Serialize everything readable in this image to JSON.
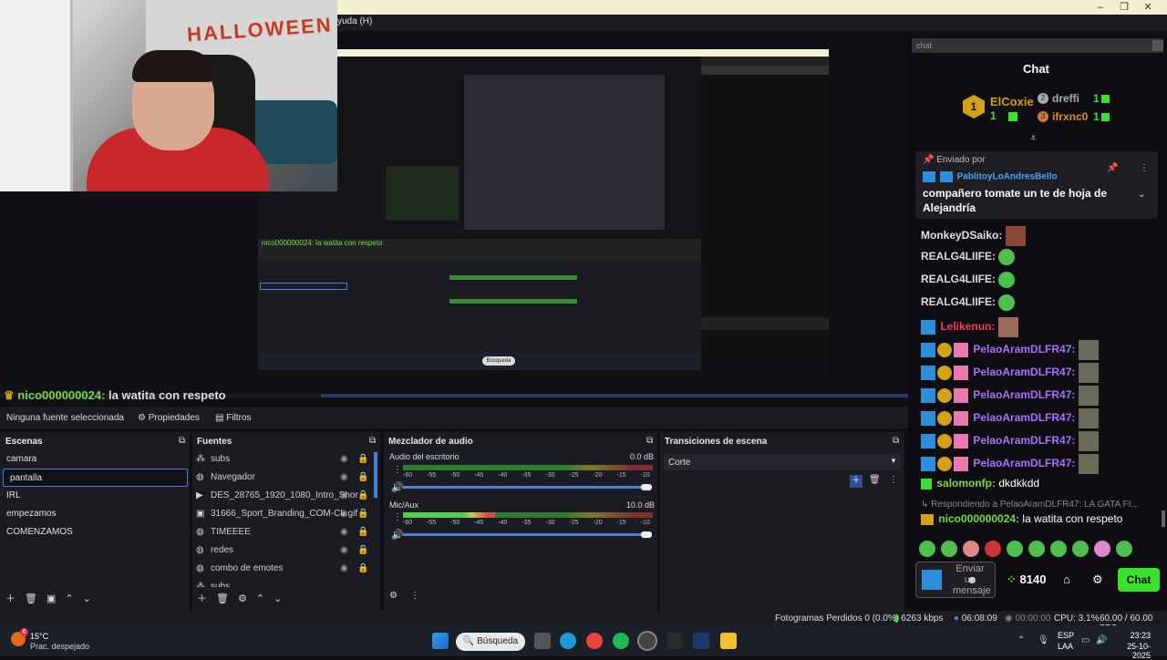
{
  "window": {
    "menu_fragment": "yuda (H)"
  },
  "webcam": {
    "banner": "HALLOWEEN"
  },
  "preview": {
    "nested_ticker": "nico000000024: la watita con respeto",
    "nested_search": "Búsqueda"
  },
  "ticker": {
    "user": "nico000000024:",
    "message": "la watita con respeto",
    "user_color": "#7bd64a"
  },
  "source_toolbar": {
    "no_source": "Ninguna fuente seleccionada",
    "properties": "Propiedades",
    "filters": "Filtros"
  },
  "scenes": {
    "title": "Escenas",
    "items": [
      "camara",
      "pantalla",
      "IRL",
      "empezamos",
      "COMENZAMOS"
    ],
    "selected": 1
  },
  "sources": {
    "title": "Fuentes",
    "items": [
      "subs",
      "Navegador",
      "DES_28765_1920_1080_Intro_Shor",
      "31666_Sport_Branding_COM-CL.gif",
      "TIMEEEE",
      "redes",
      "combo de emotes",
      "subs"
    ]
  },
  "mixer": {
    "title": "Mezclador de audio",
    "channels": [
      {
        "name": "Audio del escritorio",
        "db": "0.0 dB",
        "level": 0.0
      },
      {
        "name": "Mic/Aux",
        "db": "10.0 dB",
        "level": 0.37
      }
    ],
    "ticks": "-60 -55 -50 -45 -40 -35 -30 -25 -20 -15 -10 -5 0"
  },
  "transitions": {
    "title": "Transiciones de escena",
    "current": "Corte"
  },
  "chat": {
    "input_placeholder": "chat",
    "title": "Chat",
    "leaderboard": [
      {
        "rank": "1",
        "name": "ElCoxie",
        "count": "1"
      },
      {
        "rank": "2",
        "name": "dreffi",
        "count": "1"
      },
      {
        "rank": "3",
        "name": "ifrxnc0",
        "count": "1"
      }
    ],
    "pinned": {
      "label": "Enviado por",
      "user": "PablitoyLoAndresBello",
      "text": "compañero tomate un te de hoja de Alejandría"
    },
    "messages": [
      {
        "user": "MonkeyDSaiko:",
        "color": "#e0e0e0"
      },
      {
        "user": "REALG4LIIFE:",
        "color": "#e0e0e0"
      },
      {
        "user": "REALG4LIIFE:",
        "color": "#e0e0e0"
      },
      {
        "user": "REALG4LIIFE:",
        "color": "#e0e0e0"
      },
      {
        "user": "Lelikenun:",
        "color": "#ff3b5a"
      },
      {
        "user": "PelaoAramDLFR47:",
        "color": "#a970ff"
      },
      {
        "user": "PelaoAramDLFR47:",
        "color": "#a970ff"
      },
      {
        "user": "PelaoAramDLFR47:",
        "color": "#a970ff"
      },
      {
        "user": "PelaoAramDLFR47:",
        "color": "#a970ff"
      },
      {
        "user": "PelaoAramDLFR47:",
        "color": "#a970ff"
      },
      {
        "user": "PelaoAramDLFR47:",
        "color": "#a970ff"
      }
    ],
    "salomon": {
      "user": "salomonfp:",
      "text": "dkdkkdd"
    },
    "reply_to": "Respondiendo a PelaoAramDLFR47: LA GATA FI...",
    "nico": {
      "user": "nico000000024:",
      "text": "la watita con respeto"
    },
    "send_placeholder": "Enviar un mensaje",
    "points": "8140",
    "chat_button": "Chat"
  },
  "status": {
    "dropped": "Fotogramas Perdidos 0 (0.0%)",
    "bitrate": "6263 kbps",
    "rec": "06:08:09",
    "stream": "00:00:00",
    "cpu": "CPU: 3.1%",
    "fps": "60.00 / 60.00 FPS"
  },
  "taskbar": {
    "temp": "15°C",
    "weather": "Prac. despejado",
    "search": "Búsqueda",
    "lang1": "ESP",
    "lang2": "LAA",
    "time": "23:23",
    "date": "25-10-2025",
    "badge": "6"
  }
}
